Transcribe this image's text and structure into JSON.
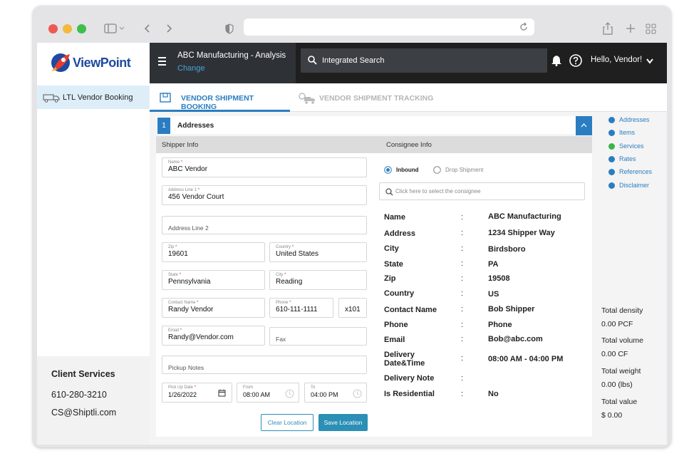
{
  "sidebar": {
    "logo_text": "ViewPoint",
    "nav_item_label": "LTL Vendor Booking",
    "client_services": {
      "title": "Client Services",
      "phone": "610-280-3210",
      "email": "CS@Shiptli.com"
    }
  },
  "header": {
    "project_title": "ABC Manufacturing - Analysis",
    "change_link": "Change",
    "search_label": "Integrated Search",
    "greeting": "Hello, Vendor!"
  },
  "tabs": {
    "active": "VENDOR SHIPMENT BOOKING",
    "inactive": "VENDOR SHIPMENT TRACKING"
  },
  "section": {
    "number": "1",
    "title": "Addresses",
    "shipper_heading": "Shipper Info",
    "consignee_heading": "Consignee Info"
  },
  "form": {
    "name": {
      "label": "Name",
      "value": "ABC Vendor"
    },
    "address1": {
      "label": "Address Line 1",
      "value": "456 Vendor Court"
    },
    "address2": {
      "placeholder": "Address Line 2"
    },
    "zip": {
      "label": "Zip",
      "value": "19601"
    },
    "country": {
      "label": "Country",
      "value": "United States"
    },
    "state": {
      "label": "State",
      "value": "Pennsylvania"
    },
    "city": {
      "label": "City",
      "value": "Reading"
    },
    "contact": {
      "label": "Contact Name",
      "value": "Randy Vendor"
    },
    "phone": {
      "label": "Phone",
      "value": "610-111-1111"
    },
    "ext": {
      "value": "x101"
    },
    "email": {
      "label": "Email",
      "value": "Randy@Vendor.com"
    },
    "fax": {
      "placeholder": "Fax"
    },
    "notes": {
      "placeholder": "Pickup Notes"
    },
    "pickup_date": {
      "label": "Pick Up Date",
      "value": "1/26/2022"
    },
    "from": {
      "label": "From",
      "value": "08:00 AM"
    },
    "to": {
      "label": "To",
      "value": "04:00 PM"
    },
    "clear_label": "Clear Location",
    "save_label": "Save Location"
  },
  "consignee": {
    "inbound_label": "Inbound",
    "drop_label": "Drop Shipment",
    "selected": "Inbound",
    "search_placeholder": "Click here to select the consignee",
    "rows": [
      {
        "label": "Name",
        "value": "ABC Manufacturing"
      },
      {
        "label": "Address",
        "value": "1234 Shipper Way"
      },
      {
        "label": "City",
        "value": "Birdsboro"
      },
      {
        "label": "State",
        "value": "PA"
      },
      {
        "label": "Zip",
        "value": "19508"
      },
      {
        "label": "Country",
        "value": "US"
      },
      {
        "label": "Contact Name",
        "value": "Bob Shipper"
      },
      {
        "label": "Phone",
        "value": "Phone"
      },
      {
        "label": "Email",
        "value": "Bob@abc.com"
      },
      {
        "label": "Delivery Date&Time",
        "label_line1": "Delivery",
        "label_line2": "Date&Time",
        "value": "08:00 AM - 04:00 PM"
      },
      {
        "label": "Delivery Note",
        "value": ""
      },
      {
        "label": "Is Residential",
        "value": "No"
      }
    ]
  },
  "side_nav": [
    {
      "label": "Addresses",
      "color": "#2b7dc1"
    },
    {
      "label": "Items",
      "color": "#2b7dc1"
    },
    {
      "label": "Services",
      "color": "#39b54a"
    },
    {
      "label": "Rates",
      "color": "#2b7dc1"
    },
    {
      "label": "References",
      "color": "#2b7dc1"
    },
    {
      "label": "Disclaimer",
      "color": "#2b7dc1"
    }
  ],
  "totals": [
    {
      "label": "Total density",
      "value": "0.00 PCF"
    },
    {
      "label": "Total volume",
      "value": "0.00 CF"
    },
    {
      "label": "Total weight",
      "value": "0.00 (lbs)"
    },
    {
      "label": "Total value",
      "value": "$ 0.00"
    }
  ],
  "colors": {
    "accent": "#2b7dc1",
    "header_bg": "#1f1f1f",
    "save_button": "#2c8fb5",
    "section_number_bg": "#2b7dc1"
  }
}
